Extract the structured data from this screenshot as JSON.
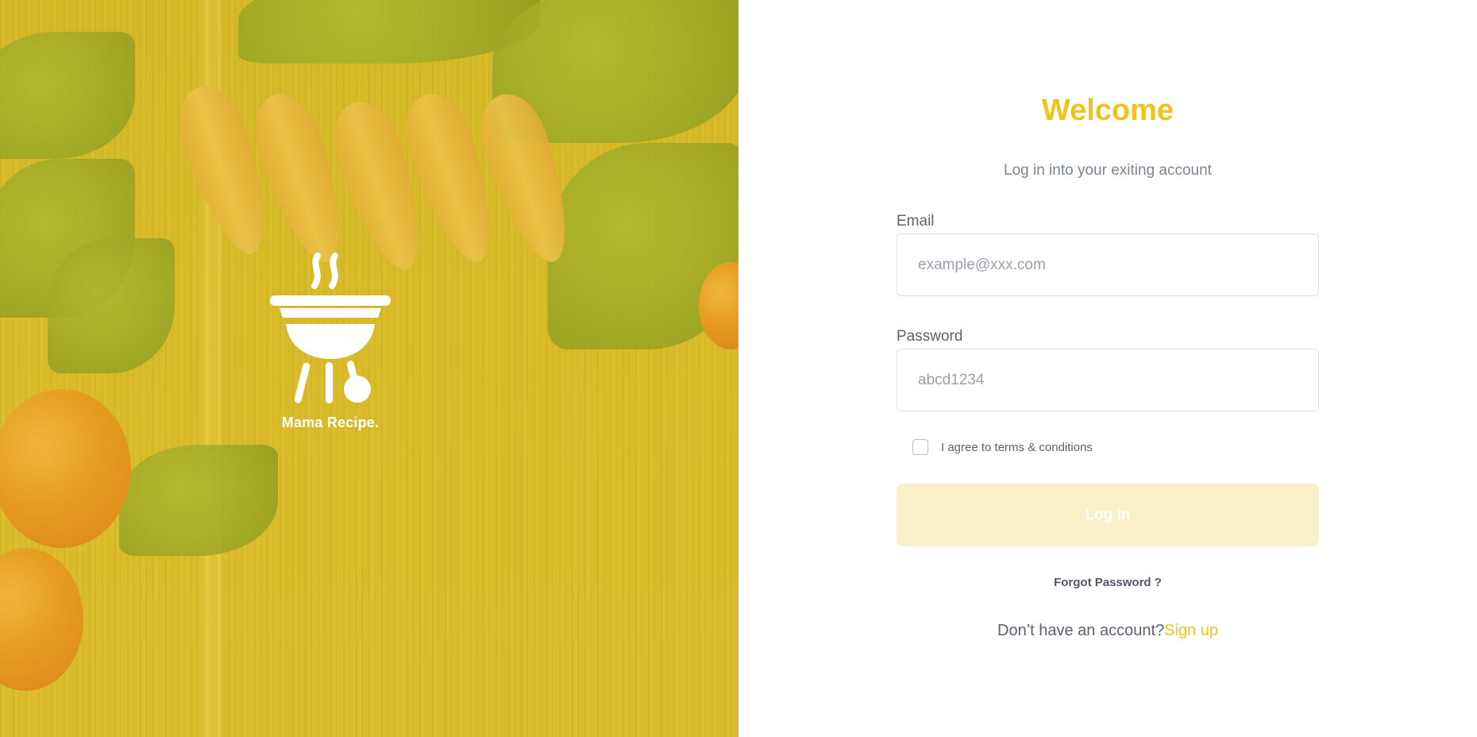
{
  "brand": {
    "name": "Mama Recipe.",
    "logo_icon": "grill-icon"
  },
  "login": {
    "title": "Welcome",
    "subtitle": "Log in into your exiting account",
    "email_label": "Email",
    "email_placeholder": "example@xxx.com",
    "email_value": "",
    "password_label": "Password",
    "password_placeholder": "abcd1234",
    "password_value": "",
    "terms_label": "I agree to terms & conditions",
    "terms_checked": false,
    "submit_label": "Log in",
    "forgot_label": "Forgot Password ?",
    "no_account_text": "Don’t have an account?",
    "signup_label": "Sign up"
  },
  "colors": {
    "accent": "#EFC31C",
    "button_disabled": "#F8F0C8",
    "hero_overlay": "#D8B92E"
  }
}
